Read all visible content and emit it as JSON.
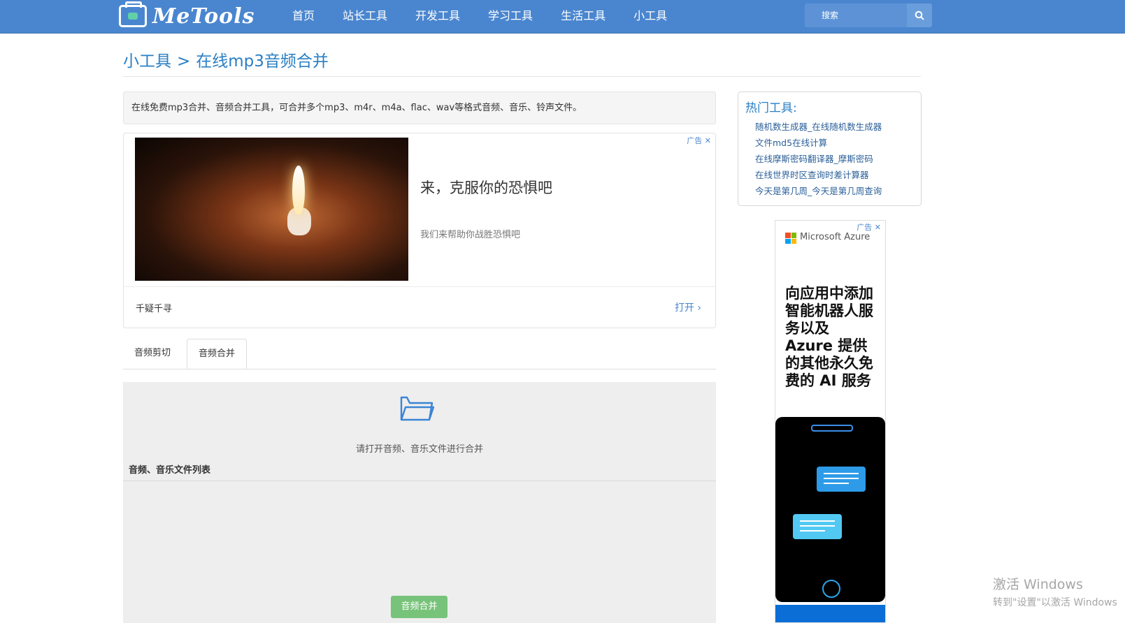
{
  "nav": {
    "logo_text": "MeTools",
    "items": [
      "首页",
      "站长工具",
      "开发工具",
      "学习工具",
      "生活工具",
      "小工具"
    ],
    "search_placeholder": "搜索"
  },
  "breadcrumb": {
    "parent": "小工具",
    "separator": ">",
    "current": "在线mp3音频合并"
  },
  "description": "在线免费mp3合并、音频合并工具，可合并多个mp3、m4r、m4a、flac、wav等格式音频、音乐、铃声文件。",
  "ad": {
    "badge": "广告",
    "headline": "来，克服你的恐惧吧",
    "subtext": "我们来帮助你战胜恐惧吧",
    "brand": "千疑千寻",
    "open_label": "打开"
  },
  "tabs": [
    {
      "label": "音频剪切",
      "active": false
    },
    {
      "label": "音频合并",
      "active": true
    }
  ],
  "panel": {
    "hint": "请打开音频、音乐文件进行合并",
    "list_title": "音频、音乐文件列表",
    "merge_button": "音频合并"
  },
  "hot_tools": {
    "title": "热门工具:",
    "items": [
      "随机数生成器_在线随机数生成器",
      "文件md5在线计算",
      "在线摩斯密码翻译器_摩斯密码",
      "在线世界时区查询时差计算器",
      "今天是第几周_今天是第几周查询"
    ]
  },
  "side_ad": {
    "badge": "广告",
    "brand": "Microsoft Azure",
    "copy": "向应用中添加智能机器人服务以及 Azure 提供的其他永久免费的 AI 服务"
  },
  "watermark": {
    "line1": "激活 Windows",
    "line2": "转到\"设置\"以激活 Windows"
  },
  "colors": {
    "nav_bg": "#4a86cf",
    "link": "#2a7fc4",
    "merge_btn": "#78c37a"
  }
}
